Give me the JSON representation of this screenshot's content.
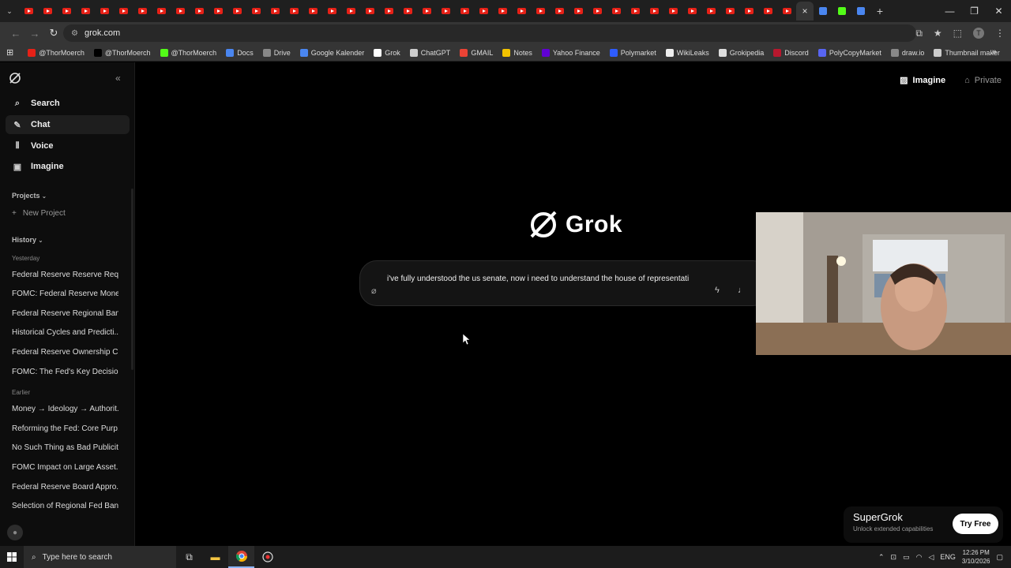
{
  "browser": {
    "url": "grok.com",
    "tabs_active_close": "×",
    "window_controls": [
      "—",
      "❐",
      "✕"
    ],
    "bookmarks": [
      {
        "label": "@ThorMoerch",
        "icon": "youtube-icon",
        "color": "#e62117"
      },
      {
        "label": "@ThorMoerch",
        "icon": "x-icon",
        "color": "#000000"
      },
      {
        "label": "@ThorMoerch",
        "icon": "kick-icon",
        "color": "#53fc18"
      },
      {
        "label": "Docs",
        "icon": "docs-icon",
        "color": "#4a86f0"
      },
      {
        "label": "Drive",
        "icon": "drive-icon",
        "color": "#888888"
      },
      {
        "label": "Google Kalender",
        "icon": "calendar-icon",
        "color": "#4a86f0"
      },
      {
        "label": "Grok",
        "icon": "grok-icon",
        "color": "#ffffff"
      },
      {
        "label": "ChatGPT",
        "icon": "chatgpt-icon",
        "color": "#cccccc"
      },
      {
        "label": "GMAIL",
        "icon": "gmail-icon",
        "color": "#ea4335"
      },
      {
        "label": "Notes",
        "icon": "notes-icon",
        "color": "#f2c200"
      },
      {
        "label": "Yahoo Finance",
        "icon": "yahoo-icon",
        "color": "#6001d2"
      },
      {
        "label": "Polymarket",
        "icon": "polymarket-icon",
        "color": "#2e5cff"
      },
      {
        "label": "WikiLeaks",
        "icon": "wikileaks-icon",
        "color": "#eeeeee"
      },
      {
        "label": "Grokipedia",
        "icon": "grokipedia-icon",
        "color": "#dddddd"
      },
      {
        "label": "Discord",
        "icon": "discord-icon",
        "color": "#b8182e"
      },
      {
        "label": "PolyCopyMarket",
        "icon": "polycopy-icon",
        "color": "#5865f2"
      },
      {
        "label": "draw.io",
        "icon": "drawio-icon",
        "color": "#888888"
      },
      {
        "label": "Thumbnail maker",
        "icon": "chatgpt-icon",
        "color": "#cccccc"
      }
    ]
  },
  "sidebar": {
    "nav": [
      {
        "label": "Search",
        "icon": "search-icon",
        "glyph": "⌕"
      },
      {
        "label": "Chat",
        "icon": "chat-icon",
        "glyph": "✎"
      },
      {
        "label": "Voice",
        "icon": "voice-icon",
        "glyph": "⫴"
      },
      {
        "label": "Imagine",
        "icon": "image-icon",
        "glyph": "▣"
      }
    ],
    "projects_label": "Projects",
    "new_project_label": "New Project",
    "history_label": "History",
    "yesterday_label": "Yesterday",
    "earlier_label": "Earlier",
    "yesterday_items": [
      "Federal Reserve Reserve Req...",
      "FOMC: Federal Reserve Mone...",
      "Federal Reserve Regional Ban...",
      "Historical Cycles and Predicti...",
      "Federal Reserve Ownership C...",
      "FOMC: The Fed's Key Decisio..."
    ],
    "earlier_items": [
      "Money → Ideology → Authorit...",
      "Reforming the Fed: Core Purp...",
      "No Such Thing as Bad Publicity",
      "FOMC Impact on Large Asset...",
      "Federal Reserve Board Appro...",
      "Selection of Regional Fed Ban..."
    ]
  },
  "header": {
    "imagine_label": "Imagine",
    "private_label": "Private"
  },
  "main": {
    "brand_name": "Grok",
    "composer_text": "i've fully understood the us senate, now i need to understand the house of representati"
  },
  "promo": {
    "title": "SuperGrok",
    "subtitle": "Unlock extended capabilities",
    "button_label": "Try Free"
  },
  "taskbar": {
    "search_placeholder": "Type here to search",
    "language": "ENG",
    "time": "12:26 PM",
    "date": "3/10/2026"
  }
}
